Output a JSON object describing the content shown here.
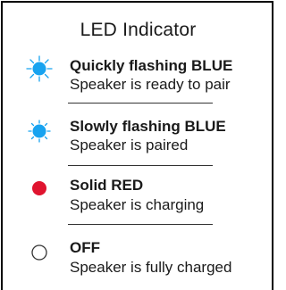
{
  "title": "LED Indicator",
  "items": [
    {
      "status": "Quickly flashing BLUE",
      "description": "Speaker is ready to pair",
      "icon": "flashing-blue-led-icon",
      "color": "#18a3f0",
      "rays": "long"
    },
    {
      "status": "Slowly flashing BLUE",
      "description": "Speaker is paired",
      "icon": "flashing-blue-led-icon",
      "color": "#18a3f0",
      "rays": "short"
    },
    {
      "status": "Solid RED",
      "description": "Speaker is charging",
      "icon": "red-led-icon",
      "color": "#e0142f"
    },
    {
      "status": "OFF",
      "description": "Speaker is fully charged",
      "icon": "off-led-icon",
      "color": "#ffffff"
    }
  ]
}
